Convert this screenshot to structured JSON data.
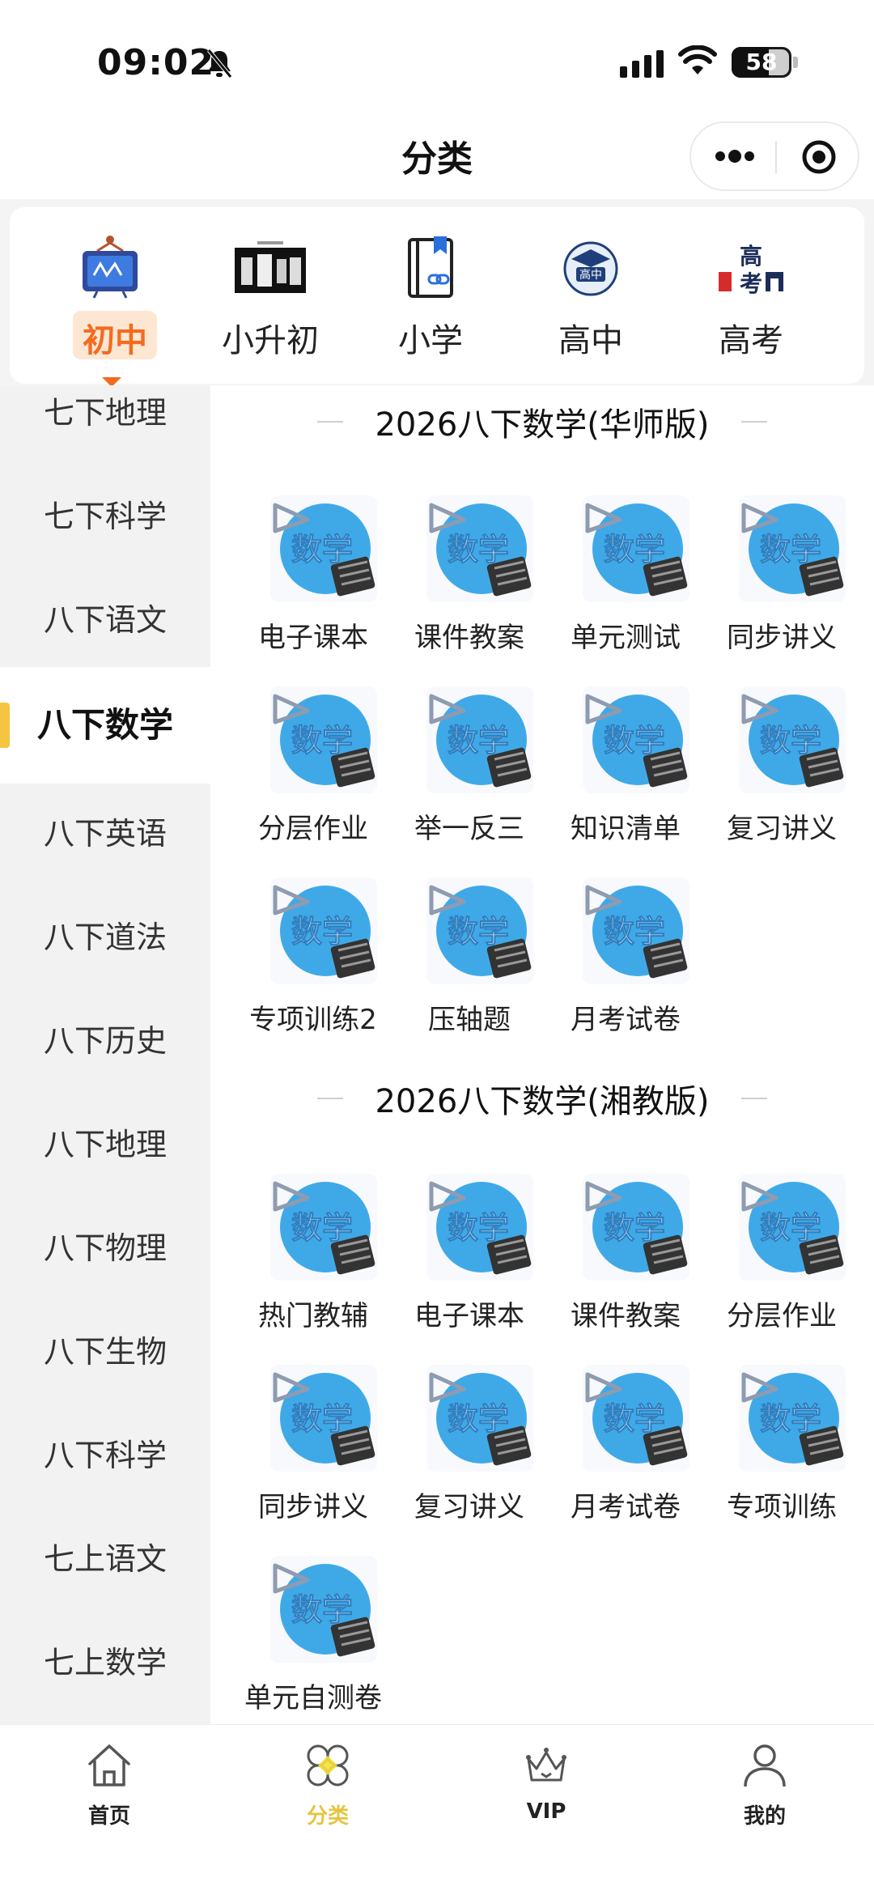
{
  "status_bar": {
    "time": "09:02",
    "battery": "58"
  },
  "nav": {
    "title": "分类"
  },
  "tabs": [
    {
      "label": "初中",
      "icon": "blackboard-icon",
      "active": true
    },
    {
      "label": "小升初",
      "icon": "promo-banner-icon",
      "active": false
    },
    {
      "label": "小学",
      "icon": "book-link-icon",
      "active": false
    },
    {
      "label": "高中",
      "icon": "high-school-badge-icon",
      "active": false
    },
    {
      "label": "高考",
      "icon": "gaokao-icon",
      "active": false
    }
  ],
  "sidebar": {
    "items": [
      {
        "label": "七下地理"
      },
      {
        "label": "七下科学"
      },
      {
        "label": "八下语文"
      },
      {
        "label": "八下数学",
        "active": true
      },
      {
        "label": "八下英语"
      },
      {
        "label": "八下道法"
      },
      {
        "label": "八下历史"
      },
      {
        "label": "八下地理"
      },
      {
        "label": "八下物理"
      },
      {
        "label": "八下生物"
      },
      {
        "label": "八下科学"
      },
      {
        "label": "七上语文"
      },
      {
        "label": "七上数学"
      }
    ]
  },
  "sections": [
    {
      "title": "2026八下数学(华师版)",
      "items": [
        {
          "label": "电子课本"
        },
        {
          "label": "课件教案"
        },
        {
          "label": "单元测试"
        },
        {
          "label": "同步讲义"
        },
        {
          "label": "分层作业"
        },
        {
          "label": "举一反三"
        },
        {
          "label": "知识清单"
        },
        {
          "label": "复习讲义"
        },
        {
          "label": "专项训练2"
        },
        {
          "label": "压轴题"
        },
        {
          "label": "月考试卷"
        }
      ]
    },
    {
      "title": "2026八下数学(湘教版)",
      "items": [
        {
          "label": "热门教辅"
        },
        {
          "label": "电子课本"
        },
        {
          "label": "课件教案"
        },
        {
          "label": "分层作业"
        },
        {
          "label": "同步讲义"
        },
        {
          "label": "复习讲义"
        },
        {
          "label": "月考试卷"
        },
        {
          "label": "专项训练"
        },
        {
          "label": "单元自测卷"
        }
      ]
    }
  ],
  "subject_icon_text": "数学",
  "bottom_tabs": [
    {
      "label": "首页",
      "icon": "home-icon"
    },
    {
      "label": "分类",
      "icon": "category-icon",
      "active": true
    },
    {
      "label": "VIP",
      "icon": "crown-icon"
    },
    {
      "label": "我的",
      "icon": "user-icon"
    }
  ],
  "colors": {
    "accent_orange": "#f36b21",
    "accent_yellow": "#f5c542",
    "icon_blue": "#3fa9e8"
  }
}
